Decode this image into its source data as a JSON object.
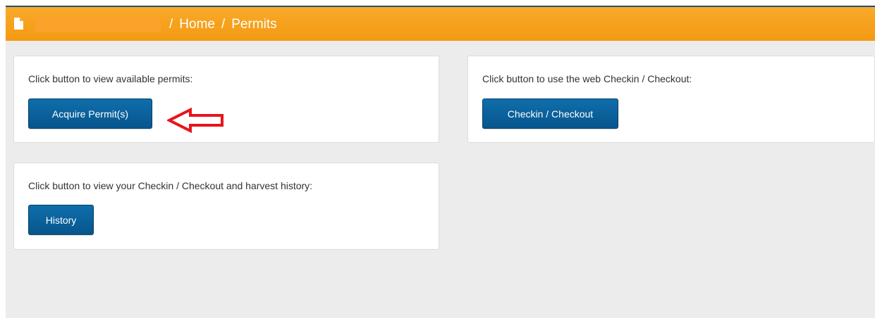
{
  "header": {
    "breadcrumb": [
      {
        "sep": "/",
        "label": "Home"
      },
      {
        "sep": "/",
        "label": "Permits"
      }
    ],
    "icon": "document-icon",
    "background_color": "#f7a11a",
    "accent_border_color": "#1e4f79"
  },
  "cards": {
    "permits": {
      "text": "Click button to view available permits:",
      "button_label": "Acquire Permit(s)"
    },
    "checkin": {
      "text": "Click button to use the web Checkin / Checkout:",
      "button_label": "Checkin / Checkout"
    },
    "history": {
      "text": "Click button to view your Checkin / Checkout and harvest history:",
      "button_label": "History"
    }
  },
  "annotation": {
    "icon": "left-arrow-icon",
    "color": "#e8141c"
  },
  "theme": {
    "button_color": "#0a629c",
    "background": "#ececec"
  }
}
